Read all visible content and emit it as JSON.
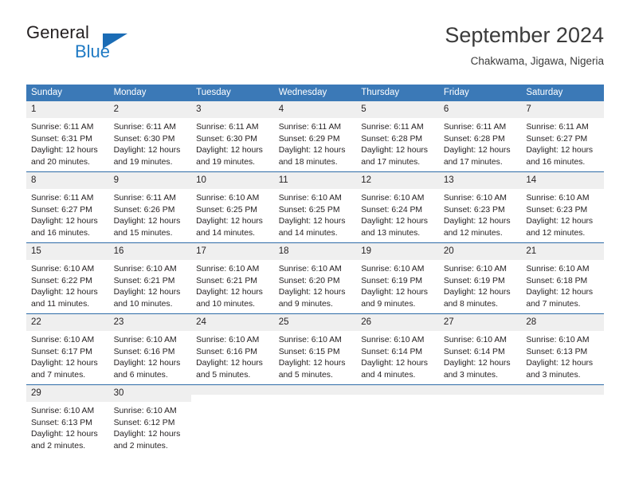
{
  "branding": {
    "logo_text_1": "General",
    "logo_text_2": "Blue",
    "triangle_color": "#1b6cb5",
    "blue_color": "#1f7ac4"
  },
  "header": {
    "title": "September 2024",
    "subtitle": "Chakwama, Jigawa, Nigeria"
  },
  "theme": {
    "header_row_bg": "#3b79b7",
    "daynum_bg": "#efefef",
    "separator": "#2f6ca8",
    "text": "#231f20"
  },
  "calendar": {
    "weekday_headers": [
      "Sunday",
      "Monday",
      "Tuesday",
      "Wednesday",
      "Thursday",
      "Friday",
      "Saturday"
    ],
    "weeks": [
      [
        {
          "day": "1",
          "sunrise": "Sunrise: 6:11 AM",
          "sunset": "Sunset: 6:31 PM",
          "daylight_1": "Daylight: 12 hours",
          "daylight_2": "and 20 minutes."
        },
        {
          "day": "2",
          "sunrise": "Sunrise: 6:11 AM",
          "sunset": "Sunset: 6:30 PM",
          "daylight_1": "Daylight: 12 hours",
          "daylight_2": "and 19 minutes."
        },
        {
          "day": "3",
          "sunrise": "Sunrise: 6:11 AM",
          "sunset": "Sunset: 6:30 PM",
          "daylight_1": "Daylight: 12 hours",
          "daylight_2": "and 19 minutes."
        },
        {
          "day": "4",
          "sunrise": "Sunrise: 6:11 AM",
          "sunset": "Sunset: 6:29 PM",
          "daylight_1": "Daylight: 12 hours",
          "daylight_2": "and 18 minutes."
        },
        {
          "day": "5",
          "sunrise": "Sunrise: 6:11 AM",
          "sunset": "Sunset: 6:28 PM",
          "daylight_1": "Daylight: 12 hours",
          "daylight_2": "and 17 minutes."
        },
        {
          "day": "6",
          "sunrise": "Sunrise: 6:11 AM",
          "sunset": "Sunset: 6:28 PM",
          "daylight_1": "Daylight: 12 hours",
          "daylight_2": "and 17 minutes."
        },
        {
          "day": "7",
          "sunrise": "Sunrise: 6:11 AM",
          "sunset": "Sunset: 6:27 PM",
          "daylight_1": "Daylight: 12 hours",
          "daylight_2": "and 16 minutes."
        }
      ],
      [
        {
          "day": "8",
          "sunrise": "Sunrise: 6:11 AM",
          "sunset": "Sunset: 6:27 PM",
          "daylight_1": "Daylight: 12 hours",
          "daylight_2": "and 16 minutes."
        },
        {
          "day": "9",
          "sunrise": "Sunrise: 6:11 AM",
          "sunset": "Sunset: 6:26 PM",
          "daylight_1": "Daylight: 12 hours",
          "daylight_2": "and 15 minutes."
        },
        {
          "day": "10",
          "sunrise": "Sunrise: 6:10 AM",
          "sunset": "Sunset: 6:25 PM",
          "daylight_1": "Daylight: 12 hours",
          "daylight_2": "and 14 minutes."
        },
        {
          "day": "11",
          "sunrise": "Sunrise: 6:10 AM",
          "sunset": "Sunset: 6:25 PM",
          "daylight_1": "Daylight: 12 hours",
          "daylight_2": "and 14 minutes."
        },
        {
          "day": "12",
          "sunrise": "Sunrise: 6:10 AM",
          "sunset": "Sunset: 6:24 PM",
          "daylight_1": "Daylight: 12 hours",
          "daylight_2": "and 13 minutes."
        },
        {
          "day": "13",
          "sunrise": "Sunrise: 6:10 AM",
          "sunset": "Sunset: 6:23 PM",
          "daylight_1": "Daylight: 12 hours",
          "daylight_2": "and 12 minutes."
        },
        {
          "day": "14",
          "sunrise": "Sunrise: 6:10 AM",
          "sunset": "Sunset: 6:23 PM",
          "daylight_1": "Daylight: 12 hours",
          "daylight_2": "and 12 minutes."
        }
      ],
      [
        {
          "day": "15",
          "sunrise": "Sunrise: 6:10 AM",
          "sunset": "Sunset: 6:22 PM",
          "daylight_1": "Daylight: 12 hours",
          "daylight_2": "and 11 minutes."
        },
        {
          "day": "16",
          "sunrise": "Sunrise: 6:10 AM",
          "sunset": "Sunset: 6:21 PM",
          "daylight_1": "Daylight: 12 hours",
          "daylight_2": "and 10 minutes."
        },
        {
          "day": "17",
          "sunrise": "Sunrise: 6:10 AM",
          "sunset": "Sunset: 6:21 PM",
          "daylight_1": "Daylight: 12 hours",
          "daylight_2": "and 10 minutes."
        },
        {
          "day": "18",
          "sunrise": "Sunrise: 6:10 AM",
          "sunset": "Sunset: 6:20 PM",
          "daylight_1": "Daylight: 12 hours",
          "daylight_2": "and 9 minutes."
        },
        {
          "day": "19",
          "sunrise": "Sunrise: 6:10 AM",
          "sunset": "Sunset: 6:19 PM",
          "daylight_1": "Daylight: 12 hours",
          "daylight_2": "and 9 minutes."
        },
        {
          "day": "20",
          "sunrise": "Sunrise: 6:10 AM",
          "sunset": "Sunset: 6:19 PM",
          "daylight_1": "Daylight: 12 hours",
          "daylight_2": "and 8 minutes."
        },
        {
          "day": "21",
          "sunrise": "Sunrise: 6:10 AM",
          "sunset": "Sunset: 6:18 PM",
          "daylight_1": "Daylight: 12 hours",
          "daylight_2": "and 7 minutes."
        }
      ],
      [
        {
          "day": "22",
          "sunrise": "Sunrise: 6:10 AM",
          "sunset": "Sunset: 6:17 PM",
          "daylight_1": "Daylight: 12 hours",
          "daylight_2": "and 7 minutes."
        },
        {
          "day": "23",
          "sunrise": "Sunrise: 6:10 AM",
          "sunset": "Sunset: 6:16 PM",
          "daylight_1": "Daylight: 12 hours",
          "daylight_2": "and 6 minutes."
        },
        {
          "day": "24",
          "sunrise": "Sunrise: 6:10 AM",
          "sunset": "Sunset: 6:16 PM",
          "daylight_1": "Daylight: 12 hours",
          "daylight_2": "and 5 minutes."
        },
        {
          "day": "25",
          "sunrise": "Sunrise: 6:10 AM",
          "sunset": "Sunset: 6:15 PM",
          "daylight_1": "Daylight: 12 hours",
          "daylight_2": "and 5 minutes."
        },
        {
          "day": "26",
          "sunrise": "Sunrise: 6:10 AM",
          "sunset": "Sunset: 6:14 PM",
          "daylight_1": "Daylight: 12 hours",
          "daylight_2": "and 4 minutes."
        },
        {
          "day": "27",
          "sunrise": "Sunrise: 6:10 AM",
          "sunset": "Sunset: 6:14 PM",
          "daylight_1": "Daylight: 12 hours",
          "daylight_2": "and 3 minutes."
        },
        {
          "day": "28",
          "sunrise": "Sunrise: 6:10 AM",
          "sunset": "Sunset: 6:13 PM",
          "daylight_1": "Daylight: 12 hours",
          "daylight_2": "and 3 minutes."
        }
      ],
      [
        {
          "day": "29",
          "sunrise": "Sunrise: 6:10 AM",
          "sunset": "Sunset: 6:13 PM",
          "daylight_1": "Daylight: 12 hours",
          "daylight_2": "and 2 minutes."
        },
        {
          "day": "30",
          "sunrise": "Sunrise: 6:10 AM",
          "sunset": "Sunset: 6:12 PM",
          "daylight_1": "Daylight: 12 hours",
          "daylight_2": "and 2 minutes."
        },
        {
          "day": "",
          "sunrise": "",
          "sunset": "",
          "daylight_1": "",
          "daylight_2": ""
        },
        {
          "day": "",
          "sunrise": "",
          "sunset": "",
          "daylight_1": "",
          "daylight_2": ""
        },
        {
          "day": "",
          "sunrise": "",
          "sunset": "",
          "daylight_1": "",
          "daylight_2": ""
        },
        {
          "day": "",
          "sunrise": "",
          "sunset": "",
          "daylight_1": "",
          "daylight_2": ""
        },
        {
          "day": "",
          "sunrise": "",
          "sunset": "",
          "daylight_1": "",
          "daylight_2": ""
        }
      ]
    ]
  }
}
